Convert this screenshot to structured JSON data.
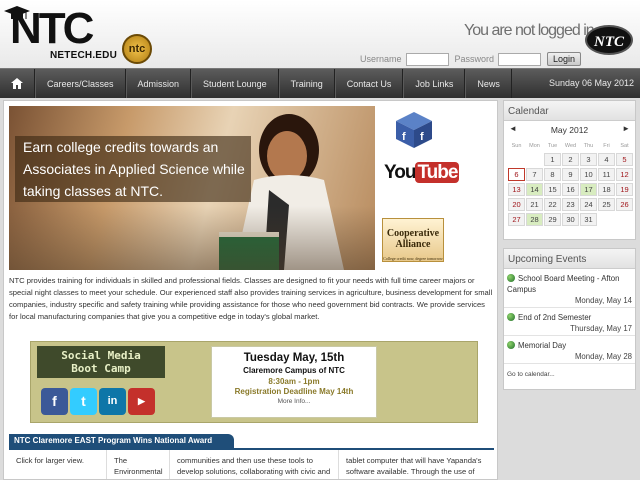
{
  "header": {
    "logo_text": "NTC",
    "logo_sub": "NETECH.EDU",
    "logo_seal": "ntc",
    "login_status": "You are not logged in.",
    "username_label": "Username",
    "password_label": "Password",
    "login_button": "Login",
    "corner_logo": "NTC"
  },
  "nav": {
    "items": [
      "Careers/Classes",
      "Admission",
      "Student Lounge",
      "Training",
      "Contact Us",
      "Job Links",
      "News"
    ],
    "date": "Sunday 06 May 2012"
  },
  "hero": {
    "caption": "Earn college credits towards an Associates in Applied Science while taking classes at NTC."
  },
  "side_logos": {
    "youtube_you": "You",
    "youtube_tube": "Tube",
    "coop_line1": "Cooperative",
    "coop_line2": "Alliance",
    "coop_small": "College credit now, degree tomorrow"
  },
  "intro": "NTC provides training for individuals in skilled and professional fields. Classes are designed to fit your needs with full time career majors or special night classes to meet your schedule. Our experienced staff also provides training services in agriculture, business development for small companies, industry specific and safety training while providing assistance for those who need government bid contracts. We provide services for local manufacturing companies that give you a competitive edge in today's global market.",
  "promo": {
    "title_line1": "Social Media",
    "title_line2": "Boot Camp",
    "date": "Tuesday May, 15th",
    "place": "Claremore Campus of NTC",
    "time": "8:30am - 1pm",
    "deadline": "Registration Deadline May 14th",
    "more": "More Info..."
  },
  "news": {
    "tab": "NTC Claremore EAST Program Wins National Award",
    "col1": "Click for larger view.",
    "col2": "The Environmental and Social",
    "col3": "communities and then use these tools to develop solutions, collaborating with civic and other groups in the process. The",
    "col4": "tablet computer that will have Yapanda's software available. Through the use of RFID technology, visitors will soon a her"
  },
  "calendar": {
    "title": "Calendar",
    "prev": "◄",
    "next": "►",
    "month": "May 2012",
    "dow": [
      "Sun",
      "Mon",
      "Tue",
      "Wed",
      "Thu",
      "Fri",
      "Sat"
    ],
    "days": [
      "",
      "",
      "1",
      "2",
      "3",
      "4",
      "5",
      "6",
      "7",
      "8",
      "9",
      "10",
      "11",
      "12",
      "13",
      "14",
      "15",
      "16",
      "17",
      "18",
      "19",
      "20",
      "21",
      "22",
      "23",
      "24",
      "25",
      "26",
      "27",
      "28",
      "29",
      "30",
      "31",
      "",
      ""
    ],
    "today": "6",
    "event_days": [
      "14",
      "17",
      "28"
    ]
  },
  "events": {
    "title": "Upcoming Events",
    "items": [
      {
        "title": "School Board Meeting - Afton Campus",
        "date": "Monday, May 14"
      },
      {
        "title": "End of 2nd Semester",
        "date": "Thursday, May 17"
      },
      {
        "title": "Memorial Day",
        "date": "Monday, May 28"
      }
    ],
    "goto": "Go to calendar..."
  },
  "colors": {
    "nav_bg": "#3a3a3a",
    "news_tab": "#1f4e79",
    "promo_bg": "#c8c48a",
    "weekend_red": "#a0161b",
    "event_green": "#d8ecc0"
  }
}
